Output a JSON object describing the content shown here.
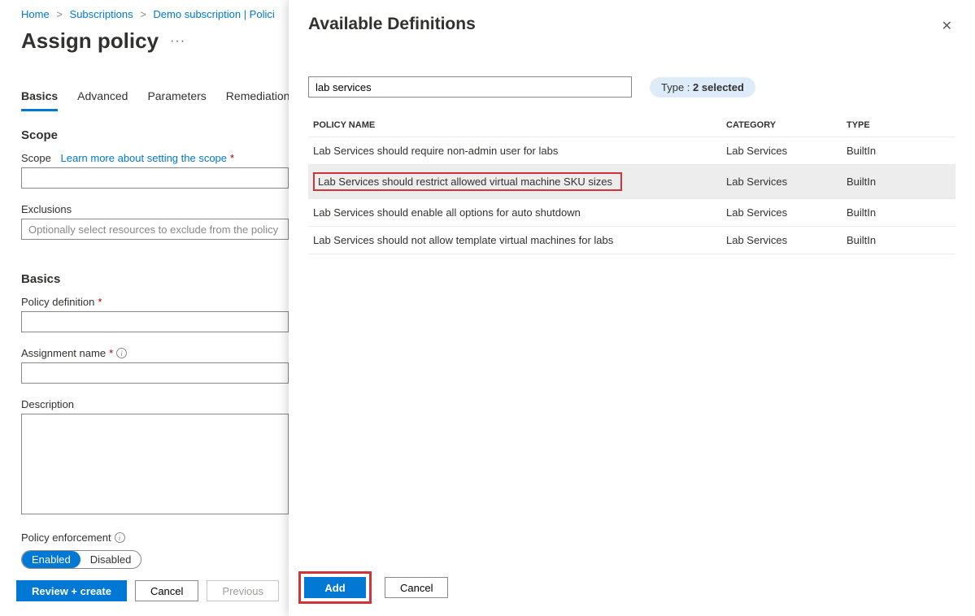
{
  "breadcrumb": {
    "items": [
      "Home",
      "Subscriptions",
      "Demo subscription | Polici"
    ],
    "last_truncated": true
  },
  "page_title": "Assign policy",
  "tabs": [
    "Basics",
    "Advanced",
    "Parameters",
    "Remediation"
  ],
  "active_tab": 0,
  "sections": {
    "scope": {
      "heading": "Scope",
      "label": "Scope",
      "link_text": "Learn more about setting the scope",
      "value": ""
    },
    "exclusions": {
      "label": "Exclusions",
      "placeholder": "Optionally select resources to exclude from the policy",
      "value": ""
    },
    "basics": {
      "heading": "Basics",
      "policy_definition_label": "Policy definition",
      "policy_definition_value": "",
      "assignment_name_label": "Assignment name",
      "assignment_name_value": "",
      "description_label": "Description",
      "description_value": "",
      "policy_enforcement_label": "Policy enforcement",
      "enforcement_options": [
        "Enabled",
        "Disabled"
      ],
      "enforcement_selected": 0
    }
  },
  "left_footer": {
    "review_create": "Review + create",
    "cancel": "Cancel",
    "previous": "Previous"
  },
  "flyout": {
    "title": "Available Definitions",
    "search_value": "lab services",
    "filter_label": "Type :",
    "filter_value": "2 selected",
    "columns": [
      "POLICY NAME",
      "CATEGORY",
      "TYPE"
    ],
    "rows": [
      {
        "name": "Lab Services should require non-admin user for labs",
        "category": "Lab Services",
        "type": "BuiltIn",
        "selected": false
      },
      {
        "name": "Lab Services should restrict allowed virtual machine SKU sizes",
        "category": "Lab Services",
        "type": "BuiltIn",
        "selected": true,
        "highlighted": true
      },
      {
        "name": "Lab Services should enable all options for auto shutdown",
        "category": "Lab Services",
        "type": "BuiltIn",
        "selected": false
      },
      {
        "name": "Lab Services should not allow template virtual machines for labs",
        "category": "Lab Services",
        "type": "BuiltIn",
        "selected": false
      }
    ],
    "footer": {
      "add": "Add",
      "cancel": "Cancel"
    }
  }
}
